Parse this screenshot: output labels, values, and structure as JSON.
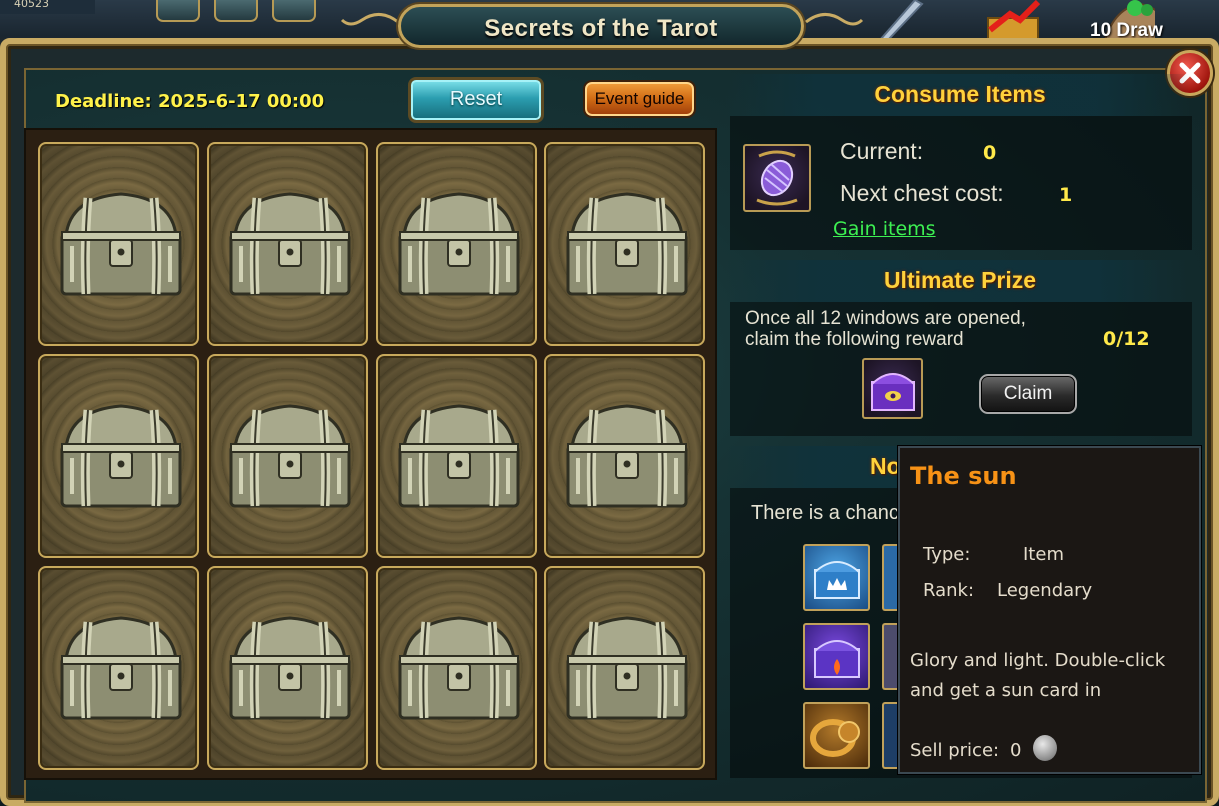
{
  "top": {
    "counter": "40523",
    "draw_label": "10 Draw"
  },
  "window": {
    "title": "Secrets of the Tarot",
    "deadline": "Deadline: 2025-6-17 00:00",
    "reset_label": "Reset",
    "guide_label": "Event guide"
  },
  "chests": [
    {
      "state": "closed"
    },
    {
      "state": "closed"
    },
    {
      "state": "closed"
    },
    {
      "state": "closed"
    },
    {
      "state": "closed"
    },
    {
      "state": "closed"
    },
    {
      "state": "closed"
    },
    {
      "state": "closed"
    },
    {
      "state": "closed"
    },
    {
      "state": "closed"
    },
    {
      "state": "closed"
    },
    {
      "state": "closed"
    }
  ],
  "consume": {
    "title": "Consume Items",
    "current_label": "Current:",
    "current_value": "0",
    "next_cost_label": "Next chest cost:",
    "next_cost_value": "1",
    "gain_link": "Gain items"
  },
  "ultimate": {
    "title": "Ultimate Prize",
    "line1": "Once all 12 windows are opened,",
    "line2": "claim the following reward",
    "progress": "0/12",
    "claim_label": "Claim"
  },
  "normal": {
    "title_partial": "No",
    "chance_text_partial": "There is a chanc"
  },
  "tooltip": {
    "title": "The sun",
    "type_label": "Type:",
    "type_value": "Item",
    "rank_label": "Rank:",
    "rank_value": "Legendary",
    "description": "Glory and light. Double-click and get a sun card in",
    "sell_label": "Sell price:",
    "sell_value": "0"
  },
  "colors": {
    "accent_gold": "#c9ab64",
    "title_yellow": "#ffd23c",
    "deadline_yellow": "#fff24a",
    "link_green": "#3df052",
    "tooltip_title": "#f79216"
  }
}
